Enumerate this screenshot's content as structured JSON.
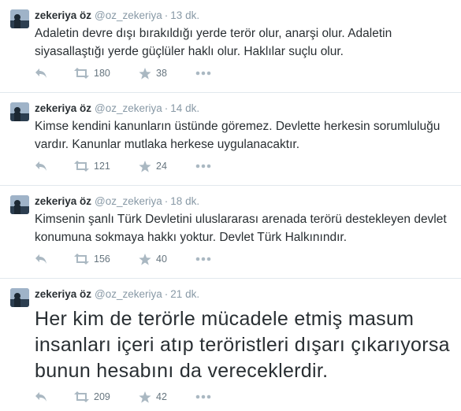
{
  "tweets": [
    {
      "name": "zekeriya öz",
      "handle": "@oz_zekeriya",
      "separator": "·",
      "time": "13 dk.",
      "text": "Adaletin devre dışı bırakıldığı yerde terör olur, anarşi olur. Adaletin siyasallaştığı yerde güçlüler haklı olur. Haklılar suçlu olur.",
      "retweets": "180",
      "favorites": "38"
    },
    {
      "name": "zekeriya öz",
      "handle": "@oz_zekeriya",
      "separator": "·",
      "time": "14 dk.",
      "text": "Kimse kendini kanunların üstünde göremez. Devlette herkesin sorumluluğu vardır. Kanunlar mutlaka herkese uygulanacaktır.",
      "retweets": "121",
      "favorites": "24"
    },
    {
      "name": "zekeriya öz",
      "handle": "@oz_zekeriya",
      "separator": "·",
      "time": "18 dk.",
      "text": "Kimsenin şanlı Türk Devletini uluslararası arenada terörü destekleyen devlet konumuna sokmaya hakkı yoktur. Devlet Türk Halkınındır.",
      "retweets": "156",
      "favorites": "40"
    },
    {
      "name": "zekeriya öz",
      "handle": "@oz_zekeriya",
      "separator": "·",
      "time": "21 dk.",
      "text": "Her kim de terörle mücadele etmiş masum insanları içeri atıp teröristleri dışarı çıkarıyorsa bunun hesabını da vereceklerdir.",
      "retweets": "209",
      "favorites": "42"
    }
  ],
  "colors": {
    "text": "#292f33",
    "muted": "#8899a6",
    "icon": "#aab8c2",
    "divider": "#e1e8ed"
  }
}
